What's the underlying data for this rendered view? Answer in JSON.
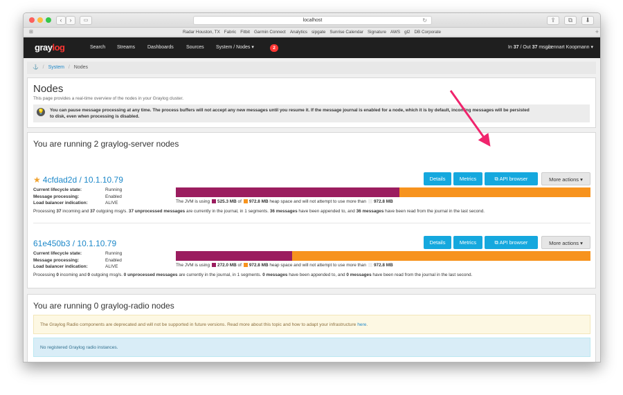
{
  "browser": {
    "url": "localhost",
    "bookmarks": [
      "Radar Houston, TX",
      "Fabric",
      "Fitbit",
      "Garmin Connect",
      "Analytics",
      "sipgate",
      "Sunrise Calendar",
      "Signature",
      "AWS",
      "gl2",
      "DB Corporate"
    ]
  },
  "nav": {
    "logo_a": "gray",
    "logo_b": "log",
    "items": [
      "Search",
      "Streams",
      "Dashboards",
      "Sources",
      "System / Nodes ▾"
    ],
    "notification_count": "2",
    "throughput_prefix": "In ",
    "throughput_in": "37",
    "throughput_mid": " / Out ",
    "throughput_out": "37",
    "throughput_suffix": " msg/s",
    "user": "Lennart Koopmann ▾"
  },
  "breadcrumb": {
    "system": "System",
    "current": "Nodes"
  },
  "header": {
    "title": "Nodes",
    "description": "This page provides a real-time overview of the nodes in your Graylog cluster.",
    "notice_a": "You can pause message processing at any time. The process buffers will not accept any new messages until you resume it. If the message journal is enabled for a node, which it is by default, incoming messages will be persisted",
    "notice_b": "to disk, even when processing is disabled."
  },
  "server_section": {
    "title": "You are running 2 graylog-server nodes",
    "buttons": {
      "details": "Details",
      "metrics": "Metrics",
      "api": "API browser",
      "more": "More actions ▾"
    },
    "labels": {
      "lifecycle": "Current lifecycle state:",
      "processing": "Message processing:",
      "lb": "Load balancer indication:"
    },
    "nodes": [
      {
        "name": "4cfdad2d / 10.1.10.79",
        "master": true,
        "lifecycle": "Running",
        "processing": "Enabled",
        "lb": "ALIVE",
        "heap_used_fraction": 0.54,
        "heap_used": "525.3 MB",
        "heap_total": "972.8 MB",
        "heap_max": "972.8 MB",
        "incoming": "37",
        "outgoing": "37",
        "unprocessed": "37 unprocessed messages",
        "segments": "1",
        "appended": "36 messages",
        "read": "36 messages"
      },
      {
        "name": "61e450b3 / 10.1.10.79",
        "master": false,
        "lifecycle": "Running",
        "processing": "Enabled",
        "lb": "ALIVE",
        "heap_used_fraction": 0.28,
        "heap_used": "272.0 MB",
        "heap_total": "972.8 MB",
        "heap_max": "972.8 MB",
        "incoming": "0",
        "outgoing": "0",
        "unprocessed": "0 unprocessed messages",
        "segments": "1",
        "appended": "0 messages",
        "read": "0 messages"
      }
    ],
    "heap_text": {
      "a": "The JVM is using",
      "b": "of",
      "c": "heap space and will not attempt to use more than"
    },
    "stats_text": {
      "p1": "Processing",
      "p2": "incoming and",
      "p3": "outgoing msg/s.",
      "p4": "are currently in the journal, in",
      "p5": "segments.",
      "p6": "have been appended to, and",
      "p7": "have been read from the journal in the last second."
    }
  },
  "radio_section": {
    "title": "You are running 0 graylog-radio nodes",
    "warning": "The Graylog Radio components are deprecated and will not be supported in future versions. Read more about this topic and how to adapt your infrastructure",
    "warning_link": "here",
    "info": "No registered Graylog radio instances."
  },
  "colors": {
    "nav_bg": "#1f1f1f",
    "accent": "#15a8de",
    "heap_used": "#9b1d5f",
    "heap_committed": "#f7931e",
    "arrow": "#f0246d"
  }
}
